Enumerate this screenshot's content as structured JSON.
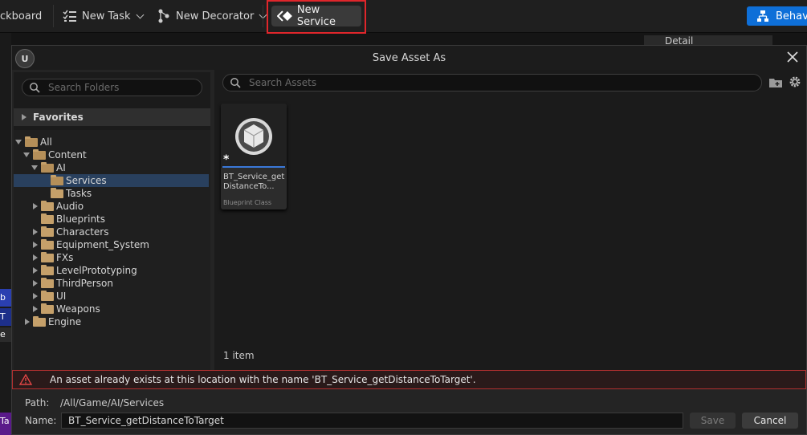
{
  "toolbar": {
    "blackboard_label": "ckboard",
    "new_task_label": "New Task",
    "new_decorator_label": "New Decorator",
    "new_service_label": "New Service",
    "behavior_label": "Behav"
  },
  "background": {
    "details_tab_label": "Detail",
    "side_fragments": [
      "b",
      "T",
      "e T",
      "Ta"
    ]
  },
  "dialog": {
    "logo_text": "U",
    "title": "Save Asset As",
    "folders_search": {
      "placeholder": "Search Folders",
      "value": ""
    },
    "favorites_label": "Favorites",
    "tree": [
      {
        "label": "All",
        "state": "expanded"
      },
      {
        "label": "Content",
        "state": "expanded"
      },
      {
        "label": "AI",
        "state": "expanded"
      },
      {
        "label": "Services",
        "state": "selected"
      },
      {
        "label": "Tasks",
        "state": "leaf"
      },
      {
        "label": "Audio",
        "state": "collapsed"
      },
      {
        "label": "Blueprints",
        "state": "leaf"
      },
      {
        "label": "Characters",
        "state": "collapsed"
      },
      {
        "label": "Equipment_System",
        "state": "collapsed"
      },
      {
        "label": "FXs",
        "state": "collapsed"
      },
      {
        "label": "LevelPrototyping",
        "state": "collapsed"
      },
      {
        "label": "ThirdPerson",
        "state": "collapsed"
      },
      {
        "label": "UI",
        "state": "collapsed"
      },
      {
        "label": "Weapons",
        "state": "collapsed"
      },
      {
        "label": "Engine",
        "state": "collapsed"
      }
    ],
    "assets_search": {
      "placeholder": "Search Assets",
      "value": ""
    },
    "asset_tile": {
      "name_line1": "BT_Service_get",
      "name_line2": "DistanceTo...",
      "type": "Blueprint Class",
      "modified_marker": "*"
    },
    "item_count": "1 item",
    "error_message": "An asset already exists at this location with the name 'BT_Service_getDistanceToTarget'.",
    "path_label": "Path:",
    "path_value": "/All/Game/AI/Services",
    "name_label": "Name:",
    "name_value": "BT_Service_getDistanceToTarget",
    "save_label": "Save",
    "cancel_label": "Cancel"
  },
  "colors": {
    "accent_blue": "#0e6fd8",
    "highlight_red": "#e0262b",
    "selection": "#29405e",
    "folder": "#c5a06a",
    "error_border": "#b23030"
  }
}
